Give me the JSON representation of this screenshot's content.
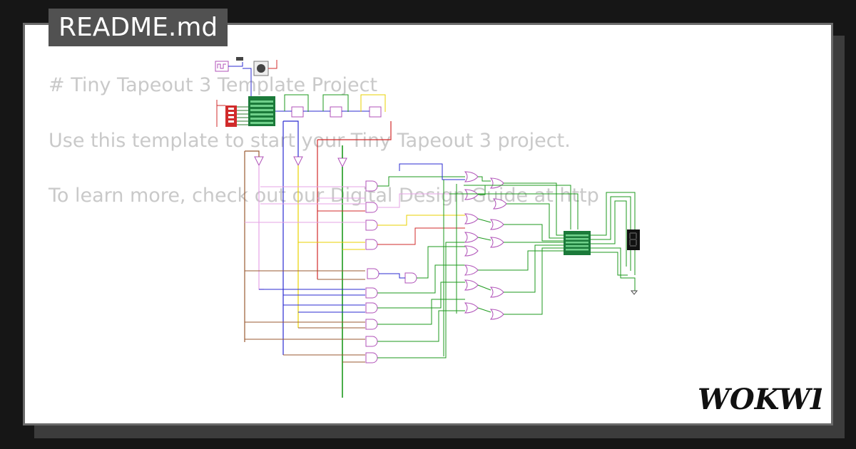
{
  "tab": {
    "title": "README.md"
  },
  "readme": {
    "heading": "# Tiny Tapeout 3 Template Project",
    "line1": "Use this template to start your Tiny Tapeout 3 project.",
    "line2": "To learn more, check out our Digital Design Guide at http"
  },
  "brand": {
    "name": "WOKWI"
  },
  "colors": {
    "background": "#161616",
    "card": "#ffffff",
    "tab": "#515151",
    "text": "#c9c9c9",
    "gate": "#d58ad8",
    "chip": "#1b7a3a",
    "wire_green": "#1e9a1e",
    "wire_blue": "#2b2bd1",
    "wire_red": "#d12b2b",
    "wire_yellow": "#e8d200",
    "wire_brown": "#9a5a32",
    "wire_pink": "#e6a3e6"
  },
  "icons": [
    "and-gate-icon",
    "or-gate-icon",
    "flip-flop-icon",
    "pushbutton-icon",
    "dip-switch-icon",
    "seven-segment-display-icon",
    "ground-icon"
  ]
}
